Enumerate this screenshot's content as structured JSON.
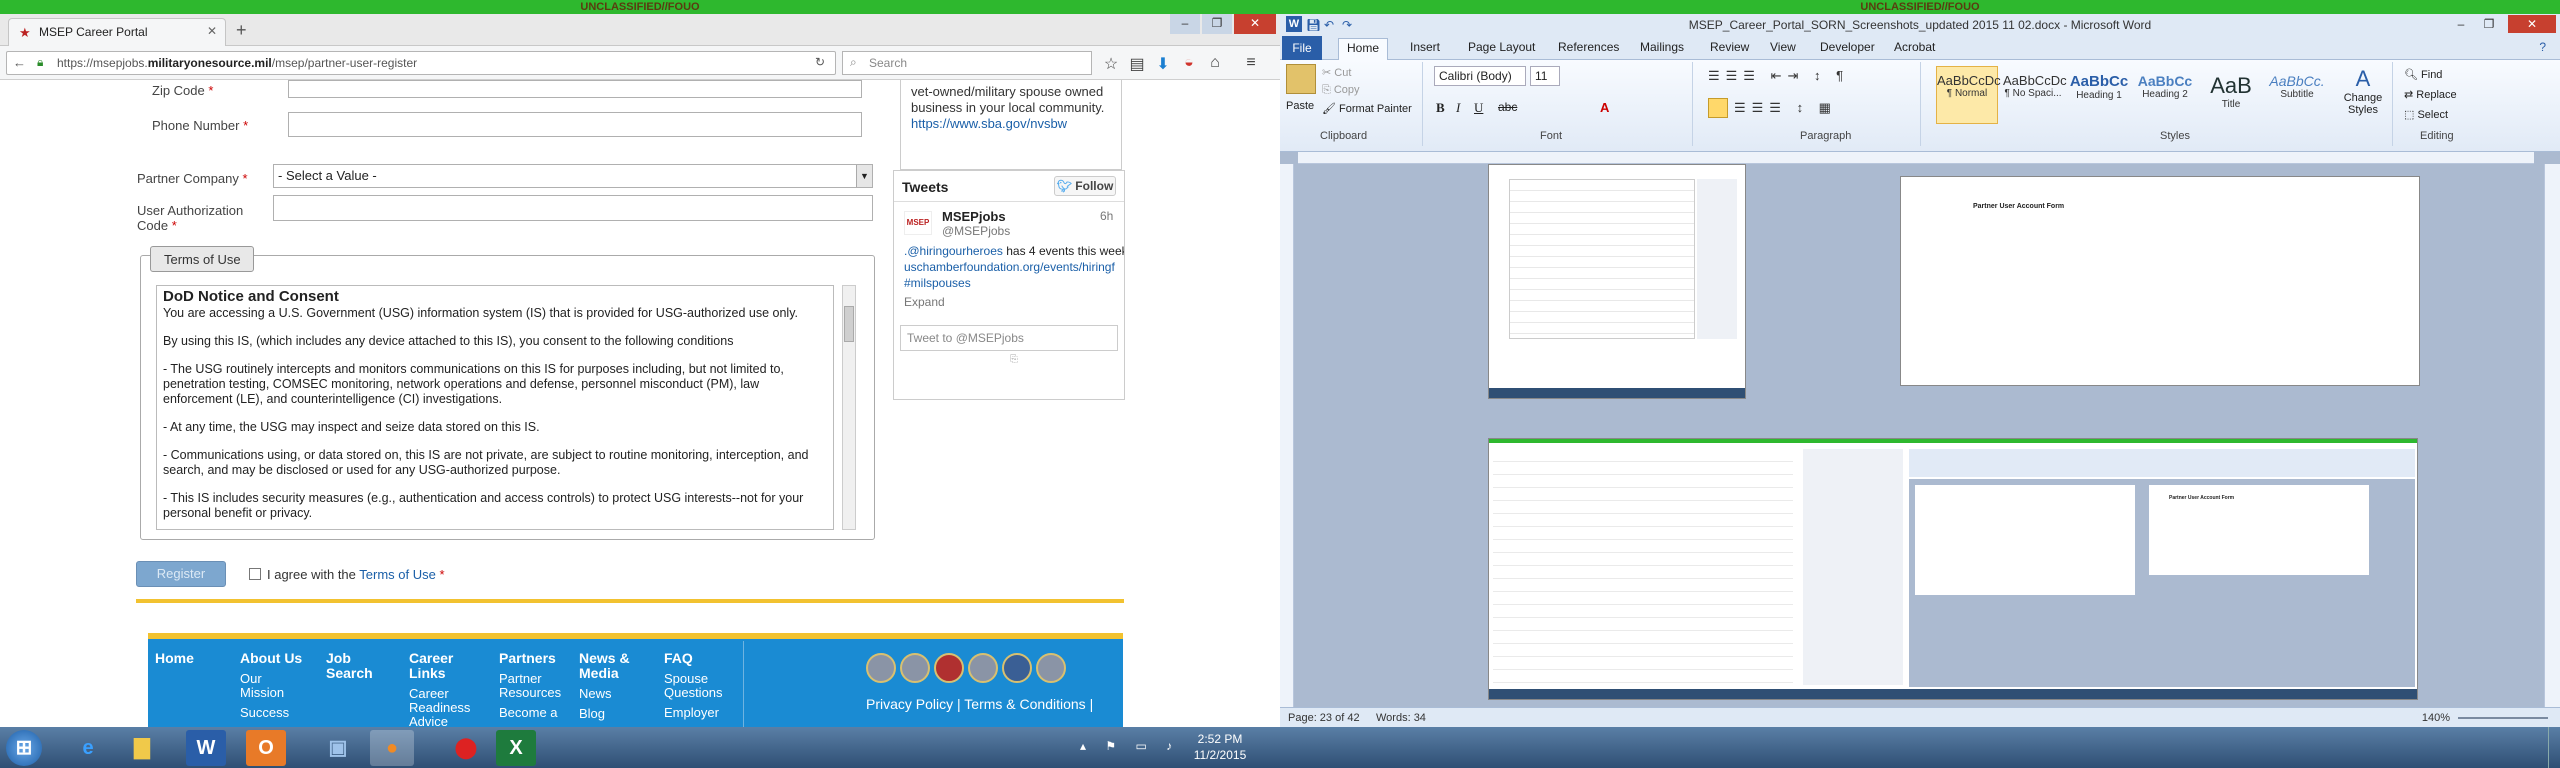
{
  "banners": {
    "left": "UNCLASSIFIED//FOUO",
    "right": "UNCLASSIFIED//FOUO"
  },
  "firefox": {
    "tab_title": "MSEP Career Portal",
    "url_prefix": "https://msepjobs.",
    "url_domain": "militaryonesource.mil",
    "url_suffix": "/msep/partner-user-register",
    "search_placeholder": "Search"
  },
  "form": {
    "zip_label": "Zip Code",
    "phone_label": "Phone Number",
    "partner_label": "Partner Company",
    "partner_value": "- Select a Value -",
    "auth_label_1": "User Authorization",
    "auth_label_2": "Code",
    "required_mark": "*",
    "terms_button": "Terms of Use",
    "register_button": "Register",
    "agree_text": "I agree with the",
    "agree_link": "Terms of Use"
  },
  "terms": {
    "title": "DoD Notice and Consent",
    "paragraphs": [
      "You are accessing a U.S. Government (USG) information system (IS) that is provided for USG-authorized use only.",
      "By using this IS, (which includes any device attached to this IS), you consent to the following conditions",
      "- The USG routinely intercepts and monitors communications on this IS for purposes including, but not limited to, penetration testing, COMSEC monitoring, network operations and defense, personnel misconduct (PM), law enforcement (LE), and counterintelligence (CI) investigations.",
      "- At any time, the USG may inspect and seize data stored on this IS.",
      "- Communications using, or data stored on, this IS are not private, are subject to routine monitoring, interception, and search, and may be disclosed or used for any USG-authorized purpose.",
      "- This IS includes security measures (e.g., authentication and access controls) to protect USG interests--not for your personal benefit or privacy."
    ]
  },
  "sidebar": {
    "partial_text": "vet-owned/military spouse owned business in your local community.",
    "partial_link": "https://www.sba.gov/nvsbw",
    "tweets_title": "Tweets",
    "follow": "Follow",
    "account_name": "MSEPjobs",
    "account_handle": "@MSEPjobs",
    "age": "6h",
    "tweet_mention": ".@hiringourheroes",
    "tweet_body": "has 4 events this week:",
    "tweet_link": "uschamberfoundation.org/events/hiringf",
    "tweet_tag": "#milspouses",
    "expand": "Expand",
    "reply_placeholder": "Tweet to @MSEPjobs"
  },
  "footer": {
    "home": "Home",
    "about": "About Us",
    "about_sub1": "Our",
    "about_sub2": "Mission",
    "about_sub3": "Success",
    "job_search_1": "Job",
    "job_search_2": "Search",
    "career_1": "Career",
    "career_2": "Links",
    "career_sub1": "Career",
    "career_sub2": "Readiness",
    "career_sub3": "Advice",
    "partners": "Partners",
    "partners_sub1": "Partner",
    "partners_sub2": "Resources",
    "partners_sub3": "Become a",
    "news_1": "News &",
    "news_2": "Media",
    "news_sub1": "News",
    "news_sub2": "Blog",
    "faq": "FAQ",
    "faq_sub1": "Spouse",
    "faq_sub2": "Questions",
    "faq_sub3": "Employer",
    "privacy": "Privacy Policy | Terms & Conditions |"
  },
  "word": {
    "title": "MSEP_Career_Portal_SORN_Screenshots_updated 2015 11 02.docx - Microsoft Word",
    "tabs": [
      "File",
      "Home",
      "Insert",
      "Page Layout",
      "References",
      "Mailings",
      "Review",
      "View",
      "Developer",
      "Acrobat"
    ],
    "clipboard": {
      "paste": "Paste",
      "cut": "Cut",
      "copy": "Copy",
      "painter": "Format Painter",
      "group": "Clipboard"
    },
    "font": {
      "name": "Calibri (Body)",
      "size": "11",
      "group": "Font"
    },
    "paragraph_group": "Paragraph",
    "styles": [
      {
        "sample": "AaBbCcDc",
        "name": "¶ Normal"
      },
      {
        "sample": "AaBbCcDc",
        "name": "¶ No Spaci..."
      },
      {
        "sample": "AaBbCc",
        "name": "Heading 1"
      },
      {
        "sample": "AaBbCc",
        "name": "Heading 2"
      },
      {
        "sample": "AaB",
        "name": "Title"
      },
      {
        "sample": "AaBbCc.",
        "name": "Subtitle"
      }
    ],
    "change_styles": "Change Styles",
    "styles_group": "Styles",
    "editing": {
      "find": "Find",
      "replace": "Replace",
      "select": "Select",
      "group": "Editing"
    },
    "doc_heading": "Partner User Account Form",
    "status_page": "Page: 23 of 42",
    "status_words": "Words: 34",
    "zoom": "140%"
  },
  "taskbar": {
    "time": "2:52 PM",
    "date": "11/2/2015"
  }
}
